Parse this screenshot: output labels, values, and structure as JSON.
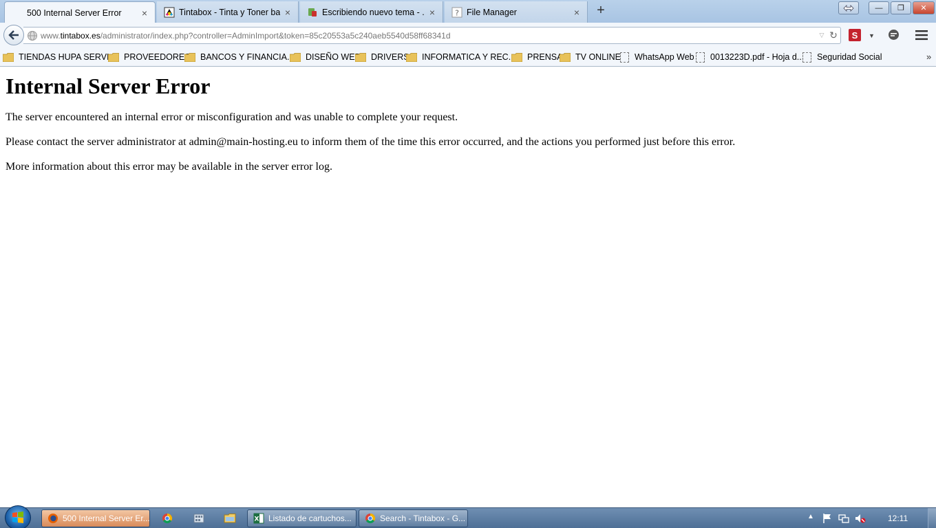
{
  "tabs": [
    {
      "label": "500 Internal Server Error",
      "active": true,
      "icon": "blank-page-icon"
    },
    {
      "label": "Tintabox - Tinta y Toner ba...",
      "active": false,
      "icon": "tintabox-logo-icon"
    },
    {
      "label": "Escribiendo nuevo tema - ...",
      "active": false,
      "icon": "forum-icon"
    },
    {
      "label": "File Manager",
      "active": false,
      "icon": "question-mark-icon"
    }
  ],
  "new_tab_label": "+",
  "tab_close_glyph": "×",
  "window_controls": {
    "minimize": "—",
    "maximize": "❐",
    "close": "✕"
  },
  "url": {
    "prefix": "www.",
    "host": "tintabox.es",
    "path": "/administrator/index.php?controller=AdminImport&token=85c20553a5c240aeb5540d58ff68341d"
  },
  "addon_label": "S",
  "bookmarks": [
    {
      "label": "TIENDAS HUPA SERVI...",
      "type": "folder"
    },
    {
      "label": "PROVEEDORES",
      "type": "folder"
    },
    {
      "label": "BANCOS Y FINANCIA...",
      "type": "folder"
    },
    {
      "label": "DISEÑO WEB",
      "type": "folder"
    },
    {
      "label": "DRIVERS",
      "type": "folder"
    },
    {
      "label": "INFORMATICA Y REC...",
      "type": "folder"
    },
    {
      "label": "PRENSA",
      "type": "folder"
    },
    {
      "label": "TV ONLINE",
      "type": "folder"
    },
    {
      "label": "WhatsApp Web",
      "type": "page"
    },
    {
      "label": "0013223D.pdf - Hoja d...",
      "type": "page"
    },
    {
      "label": "Seguridad Social",
      "type": "page"
    }
  ],
  "bookmarks_overflow": "»",
  "page": {
    "heading": "Internal Server Error",
    "paragraphs": [
      "The server encountered an internal error or misconfiguration and was unable to complete your request.",
      "Please contact the server administrator at admin@main-hosting.eu to inform them of the time this error occurred, and the actions you performed just before this error.",
      "More information about this error may be available in the server error log."
    ]
  },
  "taskbar": {
    "items": [
      {
        "label": "500 Internal Server Er...",
        "active": true
      },
      {
        "label": "Listado de cartuchos...",
        "active": false
      },
      {
        "label": "Search - Tintabox - G...",
        "active": false
      }
    ],
    "clock": "12:11"
  },
  "colors": {
    "tabstrip": "#b9d1ea",
    "toolbar": "#f2f6fb",
    "taskbar": "#5a7aa0",
    "active_taskbar_item": "#d88a5a",
    "folder": "#e8c25a"
  }
}
